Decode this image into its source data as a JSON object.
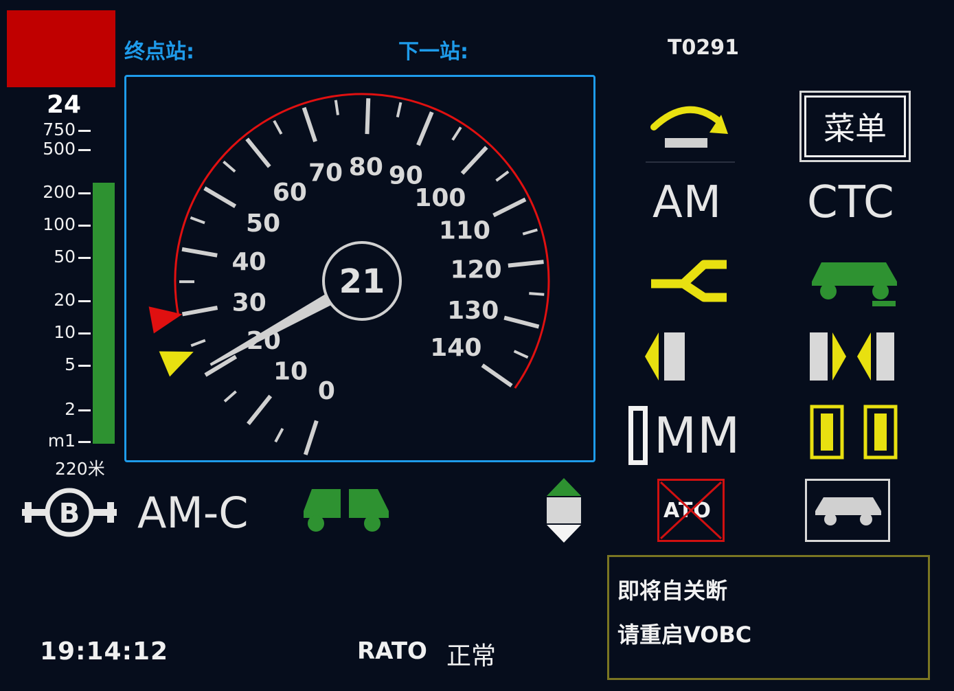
{
  "header": {
    "terminal_label": "终点站:",
    "next_station_label": "下一站:",
    "train_id": "T0291"
  },
  "distance_bar": {
    "target_value": "24",
    "scale_labels": [
      "750",
      "500",
      "200",
      "100",
      "50",
      "20",
      "10",
      "5",
      "2",
      "m1"
    ],
    "distance_text": "220米",
    "alarm_color": "#c00000",
    "bar_color": "#2e9231"
  },
  "speedometer": {
    "current_speed": "21",
    "needle_speed": 21,
    "ticks": [
      "0",
      "10",
      "20",
      "30",
      "40",
      "50",
      "60",
      "70",
      "80",
      "90",
      "100",
      "110",
      "120",
      "130",
      "140"
    ],
    "limit_arc_color": "#e01010",
    "limit_marker_speed": 30,
    "target_marker_speed": 24
  },
  "status": {
    "drive_mode": "AM",
    "control_level": "CTC",
    "manual_mode": "MM",
    "operating_mode": "AM-C",
    "ato_icon_text": "ATO"
  },
  "menu": {
    "label": "菜单"
  },
  "footer": {
    "time": "19:14:12",
    "rato_label": "RATO",
    "rato_status": "正常"
  },
  "message": {
    "line1": "即将自关断",
    "line2": "请重启VOBC"
  },
  "icons": {
    "arrow_over": "skip-station-icon",
    "switch": "turnout-icon",
    "train": "train-green-icon",
    "door_left": "left-door-icon",
    "door_both": "both-doors-icon",
    "door_yellow": "platform-door-icon",
    "car_outline": "train-gray-icon",
    "brake": "brake-b-icon",
    "coupled": "coupled-train-icon",
    "direction": "direction-icon"
  }
}
